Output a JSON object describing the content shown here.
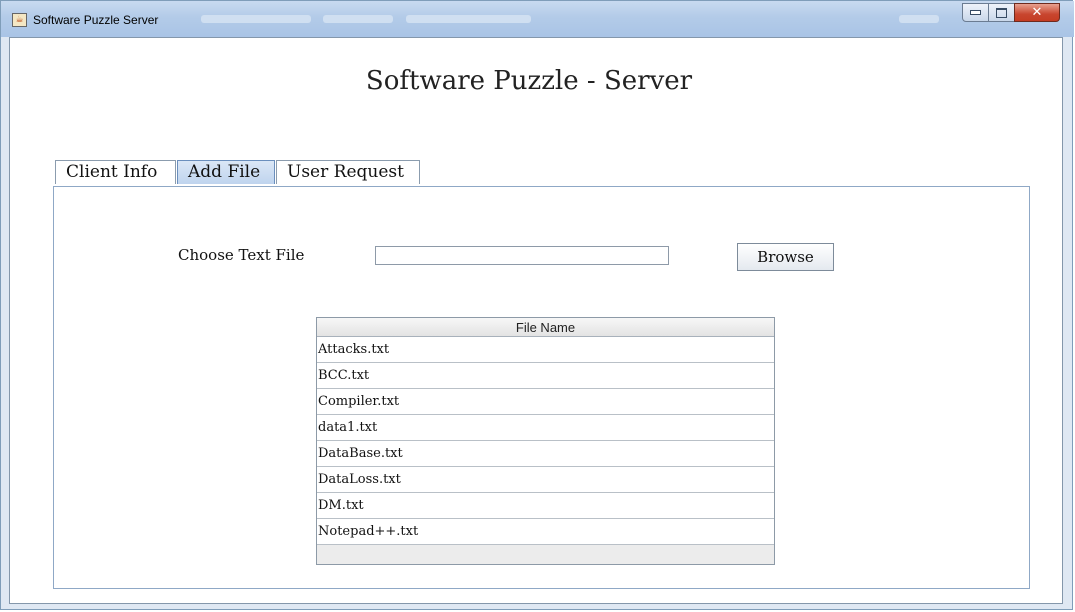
{
  "window": {
    "title": "Software Puzzle Server",
    "controls": {
      "minimize_icon": "minimize-icon",
      "maximize_icon": "maximize-icon",
      "close_icon": "close-icon",
      "close_glyph": "✕"
    }
  },
  "header": {
    "title": "Software Puzzle - Server"
  },
  "tabs": [
    {
      "label": "Client Info",
      "active": false
    },
    {
      "label": "Add File",
      "active": true
    },
    {
      "label": "User Request",
      "active": false
    }
  ],
  "add_file": {
    "choose_label": "Choose Text File",
    "file_input_value": "",
    "browse_label": "Browse"
  },
  "file_table": {
    "column_header": "File Name",
    "rows": [
      "Attacks.txt",
      "BCC.txt",
      "Compiler.txt",
      "data1.txt",
      "DataBase.txt",
      "DataLoss.txt",
      "DM.txt",
      "Notepad++.txt"
    ]
  },
  "colors": {
    "active_tab": "#c5d8ef",
    "titlebar": "#b3cbe8",
    "close_button": "#c8462f"
  }
}
